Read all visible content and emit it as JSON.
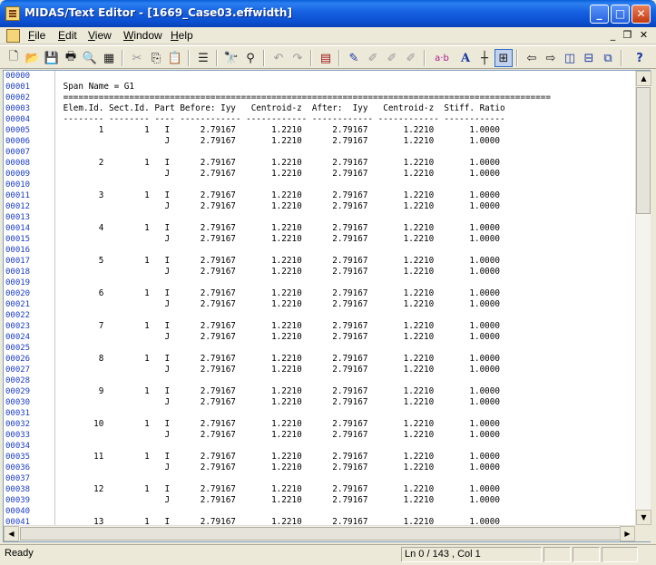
{
  "window": {
    "title": "MIDAS/Text Editor - [1669_Case03.effwidth]",
    "minimize_label": "_",
    "maximize_label": "□",
    "close_label": "✕"
  },
  "menu": {
    "items": [
      "File",
      "Edit",
      "View",
      "Window",
      "Help"
    ],
    "mdi_minimize": "_",
    "mdi_restore": "❐",
    "mdi_close": "✕"
  },
  "toolbar": {
    "buttons": [
      {
        "name": "new-file-icon",
        "glyph": "🗋"
      },
      {
        "name": "open-folder-icon",
        "glyph": "📂"
      },
      {
        "name": "save-icon",
        "glyph": "💾"
      },
      {
        "name": "print-icon",
        "glyph": "🖶"
      },
      {
        "name": "print-preview-icon",
        "glyph": "🔍"
      },
      {
        "name": "page-setup-icon",
        "glyph": "▦"
      },
      {
        "name": "cut-icon",
        "glyph": "✂"
      },
      {
        "name": "copy-icon",
        "glyph": "⎘"
      },
      {
        "name": "paste-icon",
        "glyph": "📋"
      },
      {
        "name": "column-mode-icon",
        "glyph": "☰"
      },
      {
        "name": "find-icon",
        "glyph": "🔭"
      },
      {
        "name": "find-replace-icon",
        "glyph": "⚲"
      },
      {
        "name": "undo-icon",
        "glyph": "↶"
      },
      {
        "name": "redo-icon",
        "glyph": "↷"
      },
      {
        "name": "report-icon",
        "glyph": "▤"
      },
      {
        "name": "marker-icon",
        "glyph": "✎"
      },
      {
        "name": "tool-a-icon",
        "glyph": "✐"
      },
      {
        "name": "tool-b-icon",
        "glyph": "✐"
      },
      {
        "name": "tool-c-icon",
        "glyph": "✐"
      },
      {
        "name": "ab-icon",
        "glyph": "a·b"
      },
      {
        "name": "font-icon",
        "glyph": "A"
      },
      {
        "name": "crosshair-icon",
        "glyph": "┼"
      },
      {
        "name": "fit-window-icon",
        "glyph": "⊞"
      },
      {
        "name": "prev-window-icon",
        "glyph": "⇦"
      },
      {
        "name": "next-window-icon",
        "glyph": "⇨"
      },
      {
        "name": "tile-vertical-icon",
        "glyph": "◫"
      },
      {
        "name": "tile-horizontal-icon",
        "glyph": "⊟"
      },
      {
        "name": "cascade-icon",
        "glyph": "⧉"
      },
      {
        "name": "help-icon",
        "glyph": "?"
      }
    ]
  },
  "editor": {
    "line_numbers": [
      "00000",
      "00001",
      "00002",
      "00003",
      "00004",
      "00005",
      "00006",
      "00007",
      "00008",
      "00009",
      "00010",
      "00011",
      "00012",
      "00013",
      "00014",
      "00015",
      "00016",
      "00017",
      "00018",
      "00019",
      "00020",
      "00021",
      "00022",
      "00023",
      "00024",
      "00025",
      "00026",
      "00027",
      "00028",
      "00029",
      "00030",
      "00031",
      "00032",
      "00033",
      "00034",
      "00035",
      "00036",
      "00037",
      "00038",
      "00039",
      "00040",
      "00041"
    ],
    "lines": [
      "",
      " Span Name = G1",
      " ================================================================================================",
      " Elem.Id. Sect.Id. Part Before: Iyy   Centroid-z  After:  Iyy   Centroid-z  Stiff. Ratio",
      " -------- -------- ---- ------------ ------------ ------------ ------------ ------------",
      "        1        1   I      2.79167       1.2210      2.79167       1.2210       1.0000",
      "                     J      2.79167       1.2210      2.79167       1.2210       1.0000",
      "",
      "        2        1   I      2.79167       1.2210      2.79167       1.2210       1.0000",
      "                     J      2.79167       1.2210      2.79167       1.2210       1.0000",
      "",
      "        3        1   I      2.79167       1.2210      2.79167       1.2210       1.0000",
      "                     J      2.79167       1.2210      2.79167       1.2210       1.0000",
      "",
      "        4        1   I      2.79167       1.2210      2.79167       1.2210       1.0000",
      "                     J      2.79167       1.2210      2.79167       1.2210       1.0000",
      "",
      "        5        1   I      2.79167       1.2210      2.79167       1.2210       1.0000",
      "                     J      2.79167       1.2210      2.79167       1.2210       1.0000",
      "",
      "        6        1   I      2.79167       1.2210      2.79167       1.2210       1.0000",
      "                     J      2.79167       1.2210      2.79167       1.2210       1.0000",
      "",
      "        7        1   I      2.79167       1.2210      2.79167       1.2210       1.0000",
      "                     J      2.79167       1.2210      2.79167       1.2210       1.0000",
      "",
      "        8        1   I      2.79167       1.2210      2.79167       1.2210       1.0000",
      "                     J      2.79167       1.2210      2.79167       1.2210       1.0000",
      "",
      "        9        1   I      2.79167       1.2210      2.79167       1.2210       1.0000",
      "                     J      2.79167       1.2210      2.79167       1.2210       1.0000",
      "",
      "       10        1   I      2.79167       1.2210      2.79167       1.2210       1.0000",
      "                     J      2.79167       1.2210      2.79167       1.2210       1.0000",
      "",
      "       11        1   I      2.79167       1.2210      2.79167       1.2210       1.0000",
      "                     J      2.79167       1.2210      2.79167       1.2210       1.0000",
      "",
      "       12        1   I      2.79167       1.2210      2.79167       1.2210       1.0000",
      "                     J      2.79167       1.2210      2.79167       1.2210       1.0000",
      "",
      "       13        1   I      2.79167       1.2210      2.79167       1.2210       1.0000"
    ]
  },
  "scrollbars": {
    "up_arrow": "▲",
    "down_arrow": "▼",
    "left_arrow": "◀",
    "right_arrow": "▶"
  },
  "status": {
    "message": "Ready",
    "position": "Ln 0 / 143 , Col 1"
  }
}
